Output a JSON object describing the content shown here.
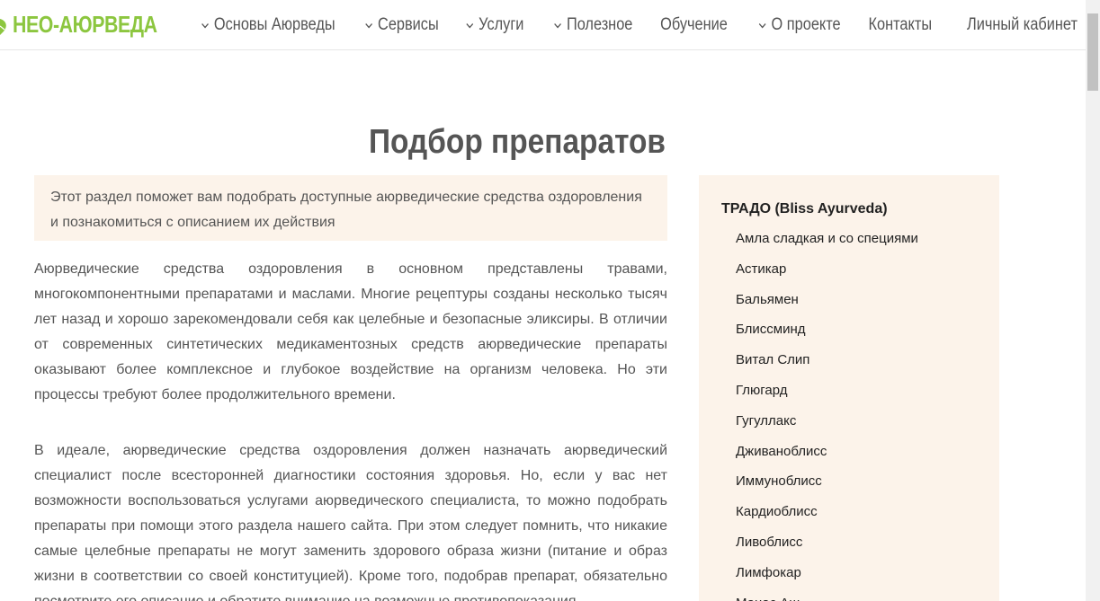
{
  "header": {
    "logo_text": "НЕО-АЮРВЕДА",
    "brand_color": "#8cc63f",
    "nav": [
      {
        "label": "Основы Аюрведы",
        "dropdown": true
      },
      {
        "label": "Сервисы",
        "dropdown": true
      },
      {
        "label": "Услуги",
        "dropdown": true
      },
      {
        "label": "Полезное",
        "dropdown": true
      },
      {
        "label": "Обучение",
        "dropdown": false
      },
      {
        "label": "О проекте",
        "dropdown": true
      },
      {
        "label": "Контакты",
        "dropdown": false
      },
      {
        "label": "Личный кабинет",
        "dropdown": false
      }
    ]
  },
  "main": {
    "title": "Подбор препаратов",
    "intro": "Этот раздел поможет вам подобрать доступные аюрведические средства оздоровления и познакомиться с описанием их действия",
    "paragraphs": [
      "Аюрведические средства оздоровления в основном представлены травами, многокомпонентными препаратами и маслами. Многие рецептуры созданы несколько тысяч лет назад и хорошо зарекомендовали себя как целебные и безопасные эликсиры. В отличии от современных синтетических медикаментозных средств аюрведические препараты оказывают более комплексное и глубокое воздействие на организм человека. Но эти процессы требуют более продолжительного времени.",
      "В идеале, аюрведические средства оздоровления должен назначать аюрведический специалист после всесторонней диагностики состояния здоровья. Но, если у вас нет возможности воспользоваться услугами аюрведического специалиста, то можно подобрать препараты при помощи этого раздела нашего сайта. При этом следует помнить, что никакие самые целебные препараты не могут заменить здорового образа жизни (питание и образ жизни в соответствии со своей конституцией). Кроме того, подобрав препарат, обязательно посмотрите его описание и обратите внимание на возможные противопоказания."
    ]
  },
  "sidebar": {
    "heading": "ТРАДО (Bliss Ayurveda)",
    "items": [
      "Амла сладкая и со специями",
      "Астикар",
      "Бальямен",
      "Блиссминд",
      "Витал Слип",
      "Глюгард",
      "Гугуллакс",
      "Дживаноблисс",
      "Иммуноблисс",
      "Кардиоблисс",
      "Ливоблисс",
      "Лимфокар",
      "Манас Аш"
    ],
    "background_color": "#fcf3ea"
  }
}
